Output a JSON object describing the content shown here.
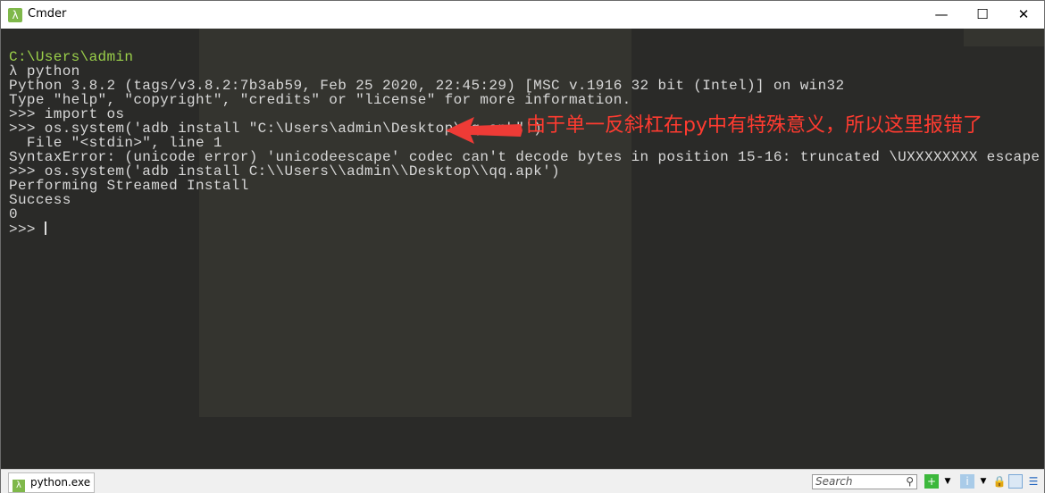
{
  "window": {
    "title": "Cmder",
    "minimize": "—",
    "maximize": "☐",
    "close": "✕",
    "app_icon": "λ"
  },
  "terminal": {
    "cwd": "C:\\Users\\admin",
    "lines": [
      "λ python",
      "Python 3.8.2 (tags/v3.8.2:7b3ab59, Feb 25 2020, 22:45:29) [MSC v.1916 32 bit (Intel)] on win32",
      "Type \"help\", \"copyright\", \"credits\" or \"license\" for more information.",
      ">>> import os",
      ">>> os.system('adb install \"C:\\Users\\admin\\Desktop\\qq.apk\"')",
      "  File \"<stdin>\", line 1",
      "SyntaxError: (unicode error) 'unicodeescape' codec can't decode bytes in position 15-16: truncated \\UXXXXXXXX escape",
      ">>> os.system('adb install C:\\\\Users\\\\admin\\\\Desktop\\\\qq.apk')",
      "Performing Streamed Install",
      "Success",
      "0"
    ],
    "prompt": ">>> "
  },
  "annotation": {
    "text": "由于单一反斜杠在py中有特殊意义，所以这里报错了",
    "color": "#ff3b30"
  },
  "statusbar": {
    "tab_label": "python.exe",
    "search_placeholder": "Search",
    "search_icon": "magnifier-icon"
  }
}
